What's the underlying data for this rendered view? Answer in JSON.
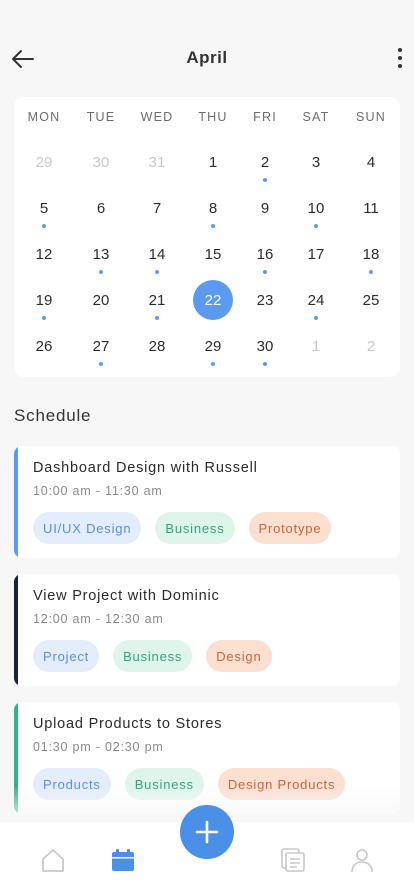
{
  "header": {
    "title": "April"
  },
  "calendar": {
    "weekdays": [
      "MON",
      "TUE",
      "WED",
      "THU",
      "FRI",
      "SAT",
      "SUN"
    ],
    "weeks": [
      [
        {
          "d": "29",
          "m": true
        },
        {
          "d": "30",
          "m": true
        },
        {
          "d": "31",
          "m": true
        },
        {
          "d": "1"
        },
        {
          "d": "2",
          "dot": true
        },
        {
          "d": "3"
        },
        {
          "d": "4"
        }
      ],
      [
        {
          "d": "5",
          "dot": true
        },
        {
          "d": "6"
        },
        {
          "d": "7"
        },
        {
          "d": "8",
          "dot": true
        },
        {
          "d": "9"
        },
        {
          "d": "10",
          "dot": true
        },
        {
          "d": "11"
        }
      ],
      [
        {
          "d": "12"
        },
        {
          "d": "13",
          "dot": true
        },
        {
          "d": "14",
          "dot": true
        },
        {
          "d": "15"
        },
        {
          "d": "16",
          "dot": true
        },
        {
          "d": "17"
        },
        {
          "d": "18",
          "dot": true
        }
      ],
      [
        {
          "d": "19",
          "dot": true
        },
        {
          "d": "20"
        },
        {
          "d": "21",
          "dot": true
        },
        {
          "d": "22",
          "sel": true
        },
        {
          "d": "23"
        },
        {
          "d": "24",
          "dot": true
        },
        {
          "d": "25"
        }
      ],
      [
        {
          "d": "26"
        },
        {
          "d": "27",
          "dot": true
        },
        {
          "d": "28"
        },
        {
          "d": "29",
          "dot": true
        },
        {
          "d": "30",
          "dot": true
        },
        {
          "d": "1",
          "m": true
        },
        {
          "d": "2",
          "m": true
        }
      ]
    ]
  },
  "schedule": {
    "title": "Schedule",
    "events": [
      {
        "title": "Dashboard Design with Russell",
        "time": "10:00 am - 11:30 am",
        "accent": "#5a9bf0",
        "tags": [
          {
            "label": "UI/UX Design",
            "kind": "blue"
          },
          {
            "label": "Business",
            "kind": "green"
          },
          {
            "label": "Prototype",
            "kind": "orange"
          }
        ]
      },
      {
        "title": "View Project with Dominic",
        "time": "12:00 am - 12:30 am",
        "accent": "#1b2235",
        "tags": [
          {
            "label": "Project",
            "kind": "blue"
          },
          {
            "label": "Business",
            "kind": "green"
          },
          {
            "label": "Design",
            "kind": "orange"
          }
        ]
      },
      {
        "title": "Upload Products to Stores",
        "time": "01:30 pm - 02:30 pm",
        "accent": "#2bb58a",
        "tags": [
          {
            "label": "Products",
            "kind": "blue"
          },
          {
            "label": "Business",
            "kind": "green"
          },
          {
            "label": "Design Products",
            "kind": "orange"
          }
        ]
      }
    ]
  },
  "colors": {
    "accent": "#5a9bf0",
    "fab": "#4a90e8",
    "tag_blue_bg": "#e3edfb",
    "tag_blue_fg": "#5a8fd6",
    "tag_green_bg": "#dff5ec",
    "tag_green_fg": "#2fa57d",
    "tag_orange_bg": "#fbe0d2",
    "tag_orange_fg": "#c0673a"
  },
  "tabbar": {
    "items": [
      {
        "icon": "home-icon",
        "active": false
      },
      {
        "icon": "calendar-icon",
        "active": true
      },
      {
        "icon": "documents-icon",
        "active": false
      },
      {
        "icon": "profile-icon",
        "active": false
      }
    ],
    "fab_icon": "plus-icon"
  }
}
